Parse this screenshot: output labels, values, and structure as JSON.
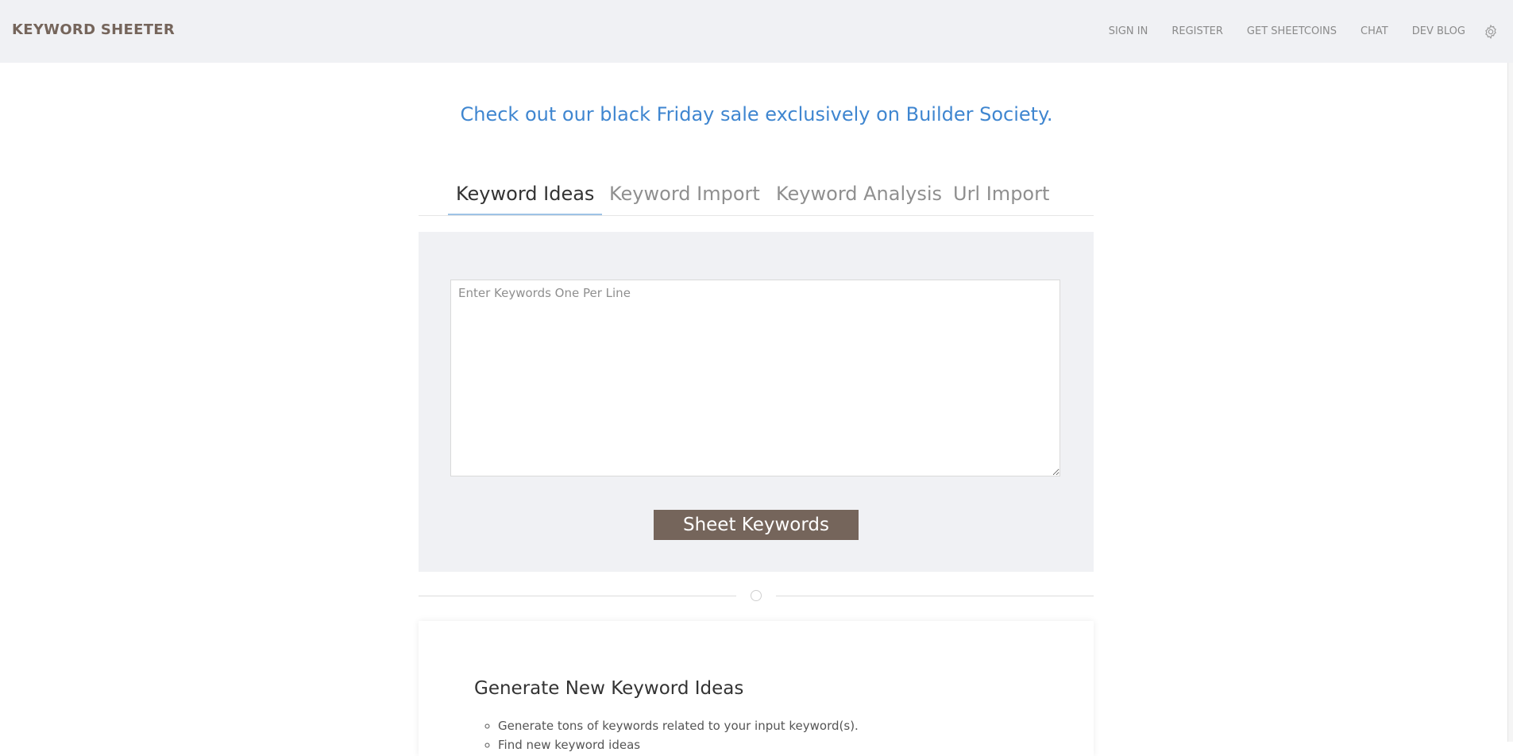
{
  "header": {
    "brand": "KEYWORD SHEETER",
    "nav": [
      "SIGN IN",
      "REGISTER",
      "GET SHEETCOINS",
      "CHAT",
      "DEV BLOG"
    ],
    "settings_icon": "gear-icon"
  },
  "promo": {
    "text": "Check out our black Friday sale exclusively on Builder Society."
  },
  "tabs": [
    "Keyword Ideas",
    "Keyword Import",
    "Keyword Analysis",
    "Url Import"
  ],
  "active_tab": "Keyword Ideas",
  "form": {
    "keywords_placeholder": "Enter Keywords One Per Line",
    "keywords_value": "",
    "submit_label": "Sheet Keywords"
  },
  "info": {
    "title": "Generate New Keyword Ideas",
    "bullets": [
      "Generate tons of keywords related to your input keyword(s).",
      "Find new keyword ideas"
    ]
  },
  "colors": {
    "brand": "#75655b",
    "link": "#3f86d0",
    "panel_bg": "#f0f1f4",
    "button": "#75655b"
  }
}
